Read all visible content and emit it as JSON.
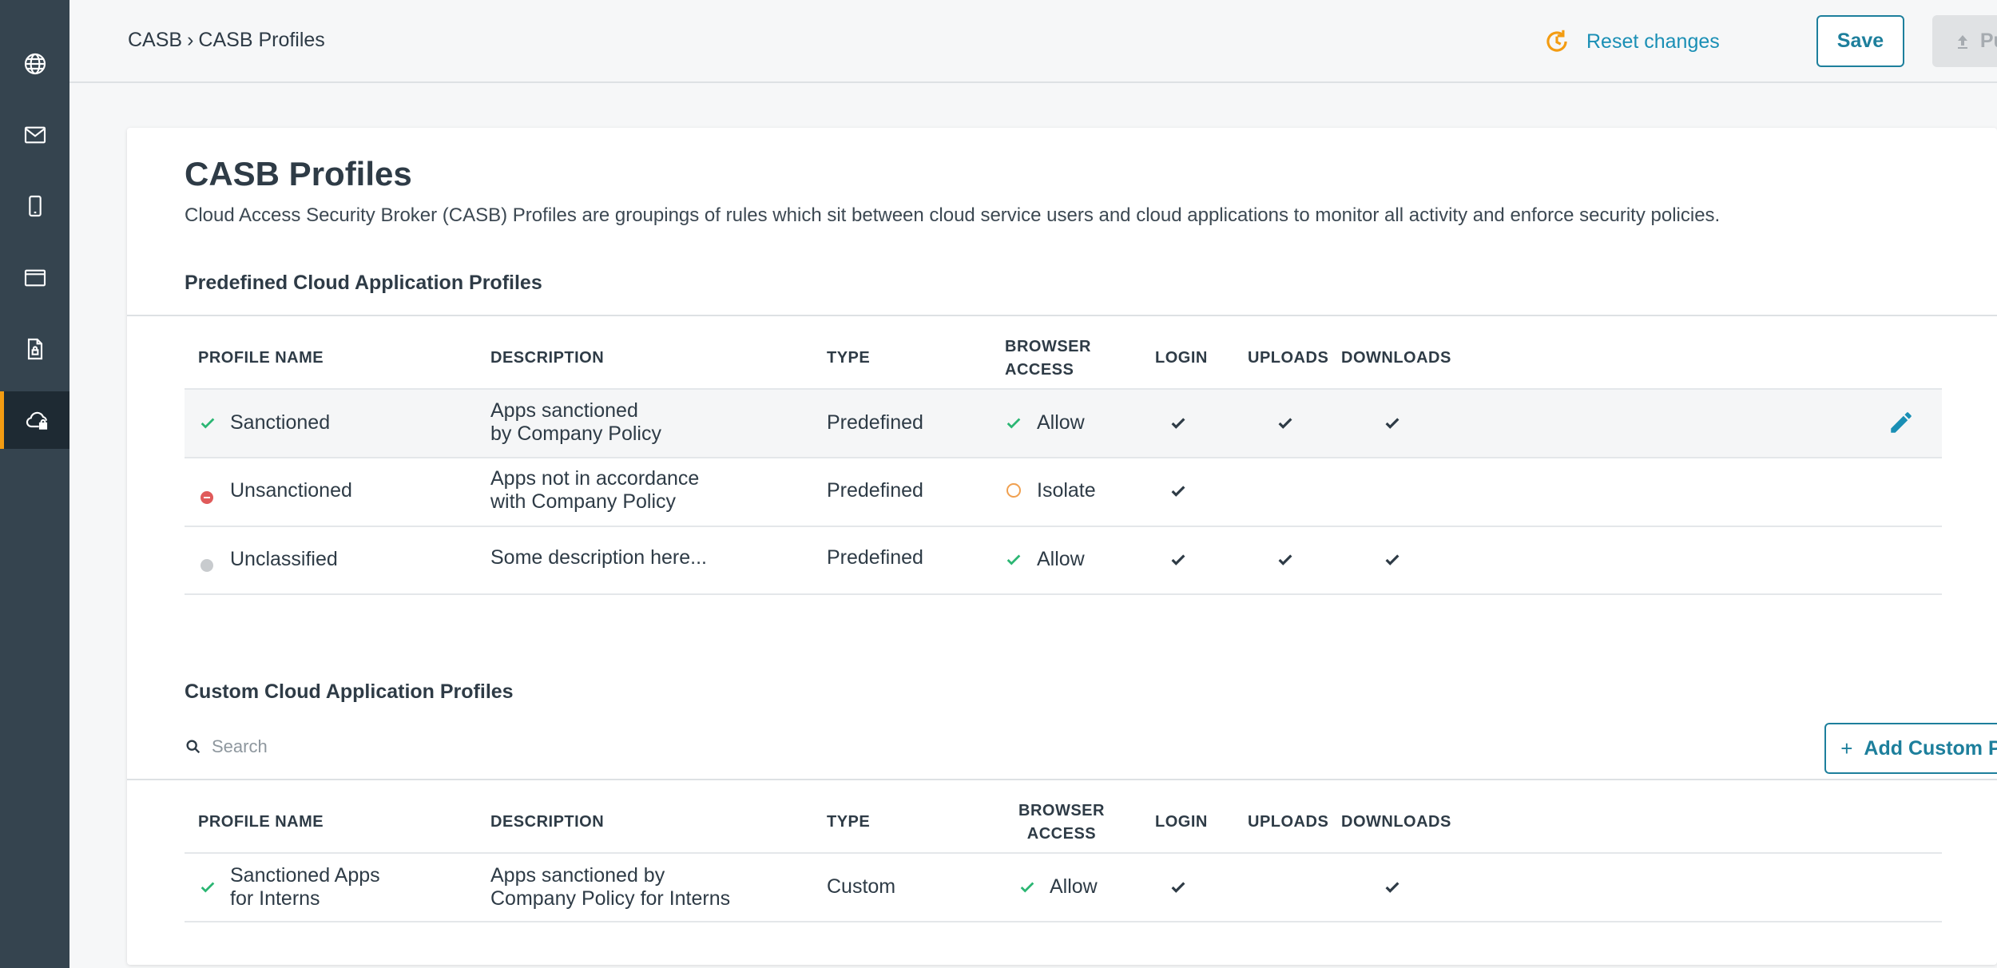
{
  "breadcrumb": {
    "root": "CASB",
    "separator": "›",
    "current": "CASB Profiles"
  },
  "toolbar": {
    "reset_label": "Reset changes",
    "save_label": "Save",
    "publish_label": "Publish"
  },
  "sidebar": {
    "items": [
      {
        "icon": "globe-icon"
      },
      {
        "icon": "mail-icon"
      },
      {
        "icon": "mobile-icon"
      },
      {
        "icon": "browser-window-icon"
      },
      {
        "icon": "secure-document-icon"
      },
      {
        "icon": "cloud-lock-icon",
        "active": true
      }
    ]
  },
  "page": {
    "title": "CASB Profiles",
    "description": "Cloud Access Security Broker (CASB) Profiles are groupings of rules which sit between cloud service users and cloud applications to monitor all activity and enforce security policies."
  },
  "predefined": {
    "title": "Predefined Cloud Application Profiles",
    "headers": {
      "name": "PROFILE NAME",
      "description": "DESCRIPTION",
      "type": "TYPE",
      "browser_1": "BROWSER",
      "browser_2": "ACCESS",
      "login": "LOGIN",
      "uploads": "UPLOADS",
      "downloads": "DOWNLOADS"
    },
    "rows": [
      {
        "status": "sanctioned",
        "name": "Sanctioned",
        "desc_1": "Apps sanctioned",
        "desc_2": "by Company Policy",
        "type": "Predefined",
        "access": "Allow",
        "login": true,
        "uploads": true,
        "downloads": true
      },
      {
        "status": "unsanctioned",
        "name": "Unsanctioned",
        "desc_1": "Apps not  in accordance",
        "desc_2": "with Company Policy",
        "type": "Predefined",
        "access": "Isolate",
        "login": true,
        "uploads": false,
        "downloads": false
      },
      {
        "status": "unclassified",
        "name": "Unclassified",
        "desc_1": "Some description here...",
        "desc_2": "",
        "type": "Predefined",
        "access": "Allow",
        "login": true,
        "uploads": true,
        "downloads": true
      }
    ]
  },
  "custom": {
    "title": "Custom Cloud Application Profiles",
    "search_placeholder": "Search",
    "add_label": "Add Custom Profile",
    "headers": {
      "name": "PROFILE NAME",
      "description": "DESCRIPTION",
      "type": "TYPE",
      "browser_1": "BROWSER",
      "browser_2": "ACCESS",
      "login": "LOGIN",
      "uploads": "UPLOADS",
      "downloads": "DOWNLOADS"
    },
    "rows": [
      {
        "status": "sanctioned",
        "name_1": "Sanctioned Apps",
        "name_2": "for Interns",
        "desc_1": "Apps sanctioned by",
        "desc_2": "Company Policy for Interns",
        "type": "Custom",
        "access": "Allow",
        "login": true,
        "uploads": false,
        "downloads": true
      }
    ]
  },
  "colors": {
    "accent": "#1d7f9c",
    "link": "#1a8fb5",
    "sidebar": "#35444f",
    "sanctioned": "#2bb673",
    "unsanctioned": "#e05a5a",
    "unclassified": "#c8cbce",
    "isolate": "#f0a050",
    "highlight": "#f39c12"
  }
}
